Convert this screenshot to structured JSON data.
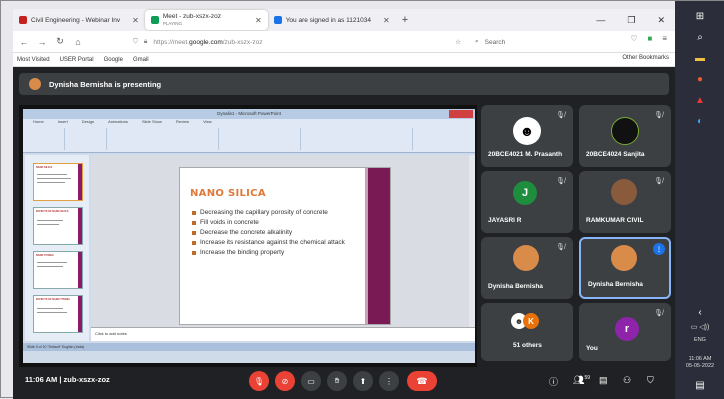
{
  "browser": {
    "tabs": [
      {
        "label": "Civil Engineering - Webinar Inv",
        "fav_color": "#c5221f"
      },
      {
        "label": "Meet - zub-xszx-zoz",
        "sub": "PLAYING",
        "fav_color": "#0f9d58"
      },
      {
        "label": "You are signed in as 1121034",
        "fav_color": "#1a73e8"
      }
    ],
    "url_prefix": "https://meet.",
    "url_domain": "google.com",
    "url_path": "/zub-xszx-zoz",
    "search_placeholder": "Search",
    "bookmarks": [
      "Most Visited",
      "USER Portal",
      "Google",
      "Gmail"
    ],
    "other_bookmarks": "Other Bookmarks"
  },
  "meet": {
    "presenting_text": "Dynisha Bernisha is presenting",
    "meeting_time": "11:06 AM",
    "meeting_code": "zub-xszx-zoz",
    "participants": [
      {
        "name": "20BCE4021 M. Prasanth",
        "muted": true
      },
      {
        "name": "20BCE4024 Sanjita",
        "muted": true
      },
      {
        "name": "JAYASRI R",
        "muted": true,
        "initial": "J",
        "color": "#1e8e3e"
      },
      {
        "name": "RAMKUMAR CIVIL",
        "muted": true
      },
      {
        "name": "Dynisha Bernisha",
        "muted": true
      },
      {
        "name": "Dynisha Bernisha",
        "speaking": true
      },
      {
        "name": "51 others",
        "initial": "K",
        "color": "#e8710a"
      },
      {
        "name": "You",
        "muted": true,
        "initial": "r",
        "color": "#8e24aa"
      }
    ],
    "participant_count": "59"
  },
  "slide": {
    "window_title": "Dynalis1 - Microsoft PowerPoint",
    "title": "NANO SILICA",
    "bullets": [
      "Decreasing the capillary porosity of concrete",
      "Fill  voids in concrete",
      "Decrease the concrete alkalinity",
      "Increase its resistance against the chemical attack",
      "Increase the binding property"
    ],
    "notes_placeholder": "Click to add notes",
    "status_text": "Slide 9 of 10    \"Default\"    English (India)",
    "ribbon_tabs": [
      "Home",
      "Insert",
      "Design",
      "Animations",
      "Slide Show",
      "Review",
      "View"
    ],
    "thumb_titles": [
      "NANO SILICA",
      "EFFECTS OF NANO SILICA",
      "NANO TITANIA",
      "EFFECTS OF NANO TITANIA"
    ]
  },
  "taskbar": {
    "lang": "ENG",
    "time": "11:06 AM",
    "date": "05-05-2022"
  }
}
